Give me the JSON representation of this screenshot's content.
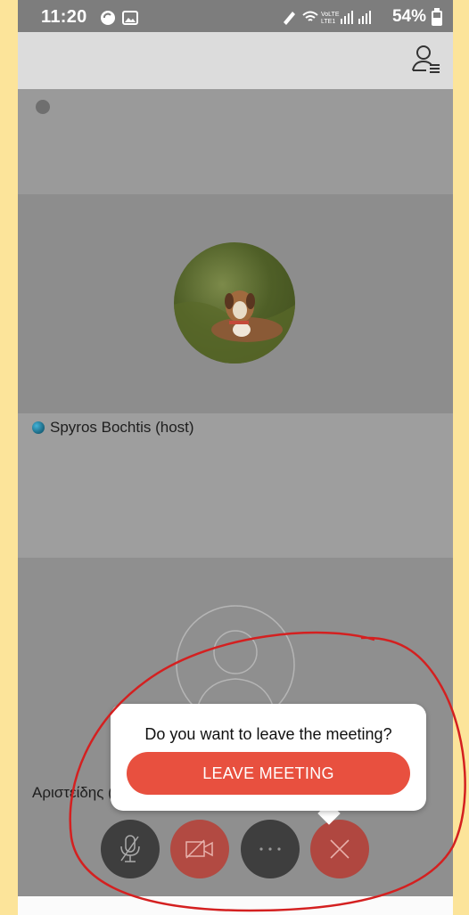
{
  "status_bar": {
    "time": "11:20",
    "battery": "54%",
    "icons": [
      "sync-icon",
      "image-icon",
      "edit-icon",
      "wifi-icon",
      "volte-icon",
      "signal-icon",
      "signal-icon",
      "battery-icon"
    ]
  },
  "top_bar": {
    "participants_icon": "participants-list-icon"
  },
  "tiles": [
    {
      "name": "",
      "indicator_icon": "audio-indicator-icon"
    },
    {
      "name": "",
      "avatar": "dog-photo-avatar"
    },
    {
      "name": "Spyros Bochtis (host)",
      "indicator_icon": "host-badge-icon"
    },
    {
      "name": "Αριστείδης (ι",
      "avatar": "default-user-avatar"
    }
  ],
  "dialog": {
    "question": "Do you want to leave the meeting?",
    "leave_label": "LEAVE MEETING"
  },
  "controls": [
    {
      "name": "mute-microphone-button",
      "icon": "microphone-muted-icon"
    },
    {
      "name": "camera-off-button",
      "icon": "camera-off-icon"
    },
    {
      "name": "more-options-button",
      "icon": "ellipsis-icon"
    },
    {
      "name": "close-button",
      "icon": "close-icon"
    }
  ],
  "colors": {
    "leave_button": "#e8503f",
    "annotation": "#d42020",
    "background": "#fce49a"
  }
}
